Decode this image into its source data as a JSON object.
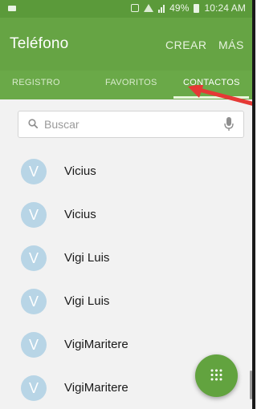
{
  "status_bar": {
    "battery": "49%",
    "time": "10:24 AM"
  },
  "app_bar": {
    "title": "Teléfono",
    "actions": [
      "CREAR",
      "MÁS"
    ]
  },
  "tabs": [
    {
      "label": "REGISTRO",
      "selected": false
    },
    {
      "label": "FAVORITOS",
      "selected": false
    },
    {
      "label": "CONTACTOS",
      "selected": true
    }
  ],
  "search": {
    "placeholder": "Buscar"
  },
  "contacts": [
    {
      "initial": "V",
      "name": "Vicius"
    },
    {
      "initial": "V",
      "name": "Vicius"
    },
    {
      "initial": "V",
      "name": "Vigi Luis"
    },
    {
      "initial": "V",
      "name": "Vigi Luis"
    },
    {
      "initial": "V",
      "name": "VigiMaritere"
    },
    {
      "initial": "V",
      "name": "VigiMaritere"
    }
  ],
  "colors": {
    "app_bar": "#66a444",
    "status_bar": "#5b9a3a",
    "avatar": "#b8d5e6",
    "fab": "#62a33f",
    "arrow": "#e53935"
  },
  "icons": {
    "search": "search-icon",
    "mic": "microphone-icon",
    "fab": "dialpad-icon",
    "annotation": "red-arrow-icon"
  }
}
